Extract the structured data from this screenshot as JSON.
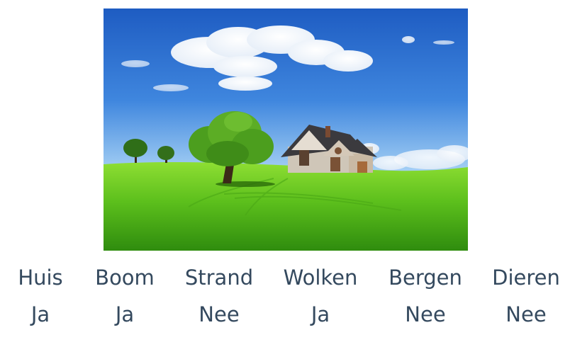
{
  "scene": {
    "icon": "landscape-house-tree-illustration"
  },
  "items": [
    {
      "word": "Huis",
      "answer": "Ja"
    },
    {
      "word": "Boom",
      "answer": "Ja"
    },
    {
      "word": "Strand",
      "answer": "Nee"
    },
    {
      "word": "Wolken",
      "answer": "Ja"
    },
    {
      "word": "Bergen",
      "answer": "Nee"
    },
    {
      "word": "Dieren",
      "answer": "Nee"
    }
  ],
  "colors": {
    "text": "#34495e",
    "sky_top": "#1f5fc0",
    "sky_bottom": "#8ec3f0",
    "grass_light": "#7fd62a",
    "grass_dark": "#3c9a12"
  }
}
